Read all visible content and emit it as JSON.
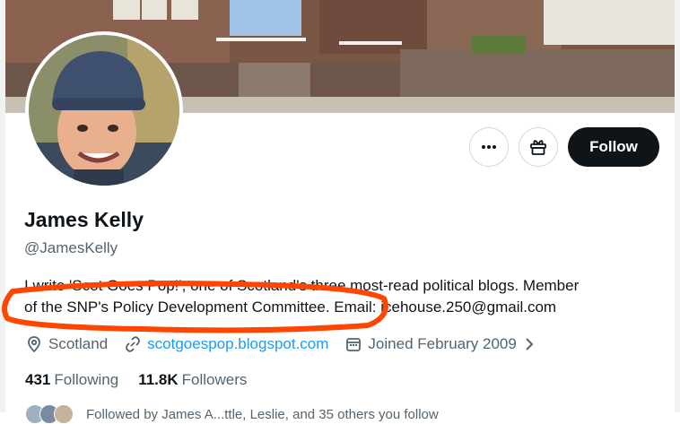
{
  "profile": {
    "name": "James Kelly",
    "handle": "@JamesKelly",
    "bio_line1": "I write 'Scot Goes Pop!', one of Scotland's three most-read political blogs.  Member",
    "bio_line2": "of the SNP's Policy Development Committee.  Email: icehouse.250@gmail.com",
    "location": "Scotland",
    "website": "scotgoespop.blogspot.com",
    "joined": "Joined February 2009",
    "following_count": "431",
    "following_label": "Following",
    "followers_count": "11.8K",
    "followers_label": "Followers",
    "followed_by_text": "Followed by James A...ttle, Leslie, and 35 others you follow"
  },
  "actions": {
    "more_icon": "more-horizontal-icon",
    "gift_icon": "gift-icon",
    "follow_label": "Follow"
  },
  "colors": {
    "text_primary": "#0f1419",
    "text_secondary": "#536471",
    "link": "#1d9bf0",
    "follow_button": "#0f1419",
    "highlight_ring": "#ff4500"
  }
}
